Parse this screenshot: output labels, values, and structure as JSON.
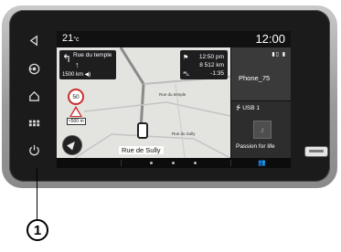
{
  "status_bar": {
    "temperature": "21",
    "temperature_unit": "°c",
    "time": "12:00"
  },
  "navigation": {
    "next_street": "Rue du temple",
    "next_distance": "1500 km",
    "eta_time": "12:50 pm",
    "remaining_distance": "8 512 km",
    "time_delta": "-1:35",
    "speed_limit": "50",
    "warning_distance": "≈500 m",
    "current_street": "Rue de Sully",
    "map_labels": [
      "Rue du temple",
      "Rue du Sully"
    ]
  },
  "phone_widget": {
    "device_name": "Phone_75"
  },
  "media_widget": {
    "source": "USB 1",
    "track_title": "Passion for life"
  },
  "callout": {
    "number": "1"
  },
  "icons": {
    "side_buttons": [
      "back-icon",
      "drive-mode-icon",
      "home-icon",
      "menu-icon",
      "power-icon"
    ]
  },
  "colors": {
    "screen_bg": "#111111",
    "map_bg": "#e3e3e0",
    "route": "#8a8a8a",
    "warning": "#c9302c"
  }
}
